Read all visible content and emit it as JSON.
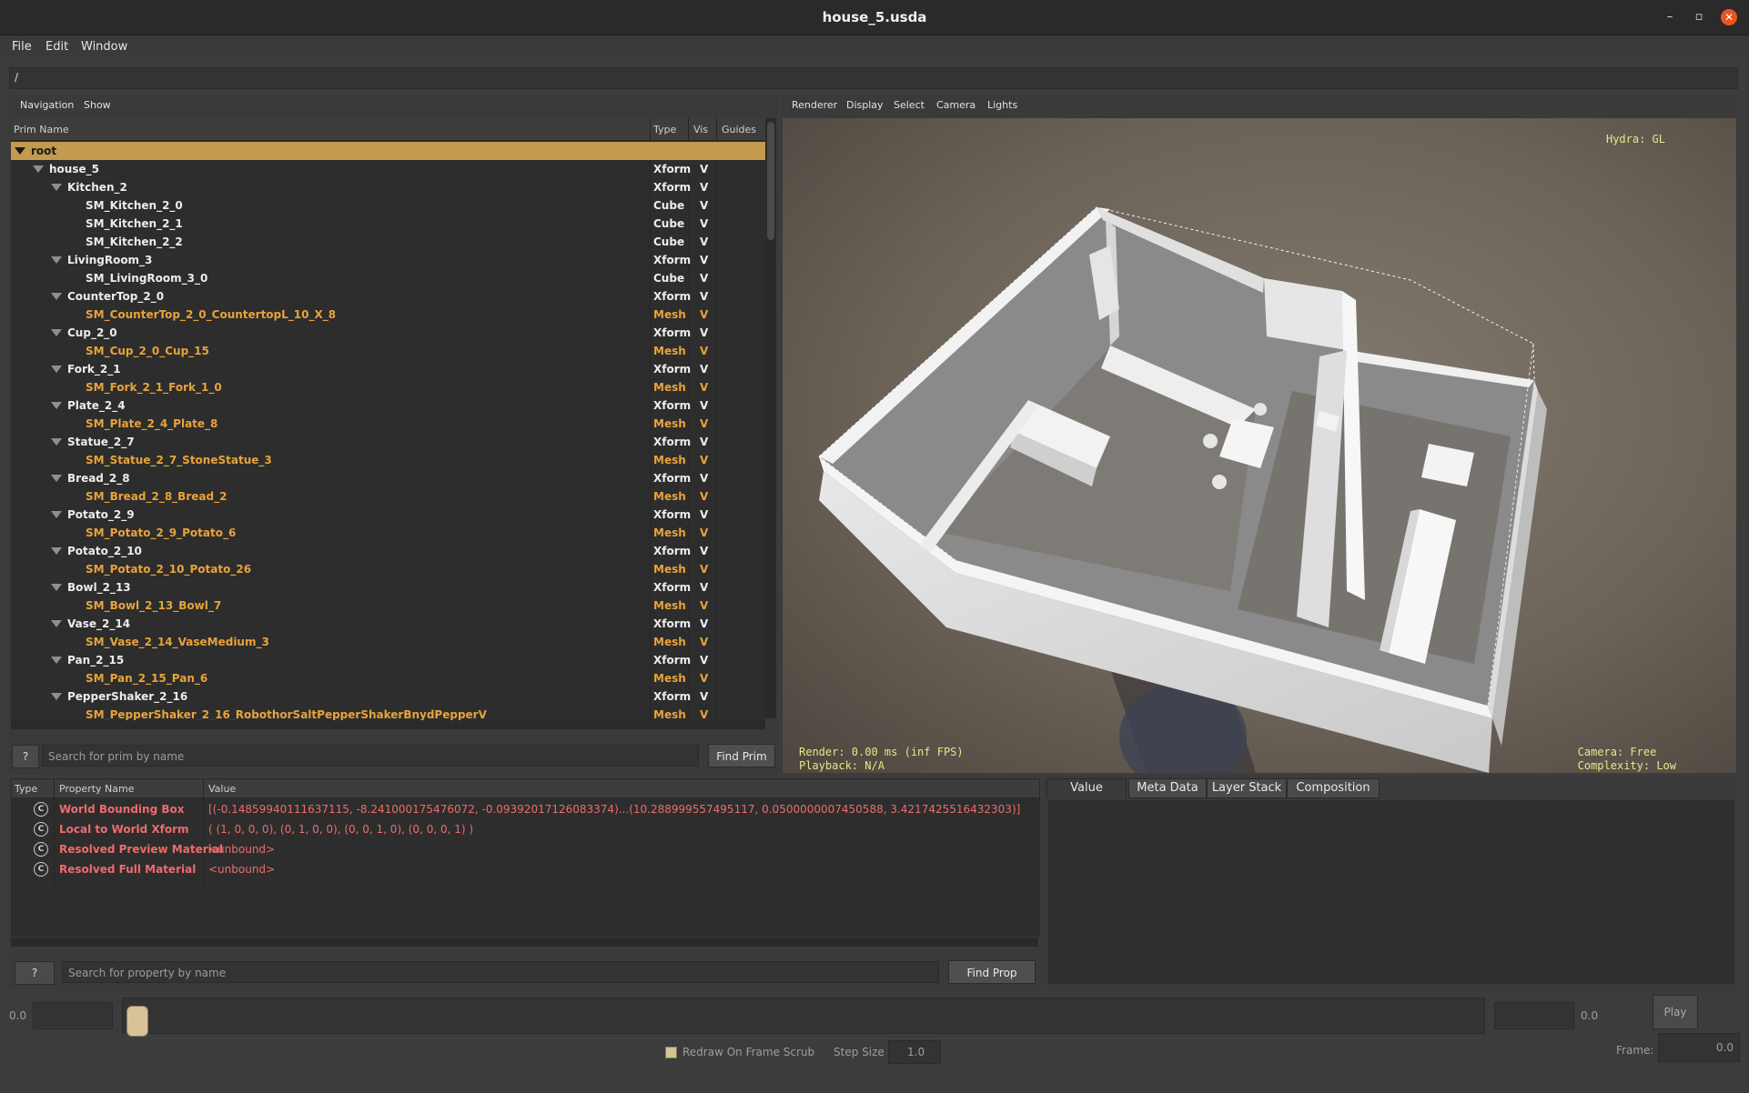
{
  "window": {
    "title": "house_5.usda",
    "controls": [
      "–",
      "▫",
      "✕"
    ]
  },
  "menu": {
    "items": [
      "File",
      "Edit",
      "Window"
    ]
  },
  "path": "/",
  "prim_panel": {
    "tabs": [
      "Navigation",
      "Show"
    ],
    "columns": [
      "Prim Name",
      "Type",
      "Vis",
      "Guides"
    ],
    "rows": [
      {
        "name": "root",
        "type": "",
        "vis": "",
        "color": "sel",
        "indent": 0,
        "expanded": true
      },
      {
        "name": "house_5",
        "type": "Xform",
        "vis": "V",
        "color": "white",
        "indent": 1,
        "expanded": true
      },
      {
        "name": "Kitchen_2",
        "type": "Xform",
        "vis": "V",
        "color": "white",
        "indent": 2,
        "expanded": true
      },
      {
        "name": "SM_Kitchen_2_0",
        "type": "Cube",
        "vis": "V",
        "color": "white",
        "indent": 3
      },
      {
        "name": "SM_Kitchen_2_1",
        "type": "Cube",
        "vis": "V",
        "color": "white",
        "indent": 3
      },
      {
        "name": "SM_Kitchen_2_2",
        "type": "Cube",
        "vis": "V",
        "color": "white",
        "indent": 3
      },
      {
        "name": "LivingRoom_3",
        "type": "Xform",
        "vis": "V",
        "color": "white",
        "indent": 2,
        "expanded": true
      },
      {
        "name": "SM_LivingRoom_3_0",
        "type": "Cube",
        "vis": "V",
        "color": "white",
        "indent": 3
      },
      {
        "name": "CounterTop_2_0",
        "type": "Xform",
        "vis": "V",
        "color": "white",
        "indent": 2,
        "expanded": true
      },
      {
        "name": "SM_CounterTop_2_0_CountertopL_10_X_8",
        "type": "Mesh",
        "vis": "V",
        "color": "orange",
        "indent": 3
      },
      {
        "name": "Cup_2_0",
        "type": "Xform",
        "vis": "V",
        "color": "white",
        "indent": 2,
        "expanded": true
      },
      {
        "name": "SM_Cup_2_0_Cup_15",
        "type": "Mesh",
        "vis": "V",
        "color": "orange",
        "indent": 3
      },
      {
        "name": "Fork_2_1",
        "type": "Xform",
        "vis": "V",
        "color": "white",
        "indent": 2,
        "expanded": true
      },
      {
        "name": "SM_Fork_2_1_Fork_1_0",
        "type": "Mesh",
        "vis": "V",
        "color": "orange",
        "indent": 3
      },
      {
        "name": "Plate_2_4",
        "type": "Xform",
        "vis": "V",
        "color": "white",
        "indent": 2,
        "expanded": true
      },
      {
        "name": "SM_Plate_2_4_Plate_8",
        "type": "Mesh",
        "vis": "V",
        "color": "orange",
        "indent": 3
      },
      {
        "name": "Statue_2_7",
        "type": "Xform",
        "vis": "V",
        "color": "white",
        "indent": 2,
        "expanded": true
      },
      {
        "name": "SM_Statue_2_7_StoneStatue_3",
        "type": "Mesh",
        "vis": "V",
        "color": "orange",
        "indent": 3
      },
      {
        "name": "Bread_2_8",
        "type": "Xform",
        "vis": "V",
        "color": "white",
        "indent": 2,
        "expanded": true
      },
      {
        "name": "SM_Bread_2_8_Bread_2",
        "type": "Mesh",
        "vis": "V",
        "color": "orange",
        "indent": 3
      },
      {
        "name": "Potato_2_9",
        "type": "Xform",
        "vis": "V",
        "color": "white",
        "indent": 2,
        "expanded": true
      },
      {
        "name": "SM_Potato_2_9_Potato_6",
        "type": "Mesh",
        "vis": "V",
        "color": "orange",
        "indent": 3
      },
      {
        "name": "Potato_2_10",
        "type": "Xform",
        "vis": "V",
        "color": "white",
        "indent": 2,
        "expanded": true
      },
      {
        "name": "SM_Potato_2_10_Potato_26",
        "type": "Mesh",
        "vis": "V",
        "color": "orange",
        "indent": 3
      },
      {
        "name": "Bowl_2_13",
        "type": "Xform",
        "vis": "V",
        "color": "white",
        "indent": 2,
        "expanded": true
      },
      {
        "name": "SM_Bowl_2_13_Bowl_7",
        "type": "Mesh",
        "vis": "V",
        "color": "orange",
        "indent": 3
      },
      {
        "name": "Vase_2_14",
        "type": "Xform",
        "vis": "V",
        "color": "white",
        "indent": 2,
        "expanded": true
      },
      {
        "name": "SM_Vase_2_14_VaseMedium_3",
        "type": "Mesh",
        "vis": "V",
        "color": "orange",
        "indent": 3
      },
      {
        "name": "Pan_2_15",
        "type": "Xform",
        "vis": "V",
        "color": "white",
        "indent": 2,
        "expanded": true
      },
      {
        "name": "SM_Pan_2_15_Pan_6",
        "type": "Mesh",
        "vis": "V",
        "color": "orange",
        "indent": 3
      },
      {
        "name": "PepperShaker_2_16",
        "type": "Xform",
        "vis": "V",
        "color": "white",
        "indent": 2,
        "expanded": true
      },
      {
        "name": "SM_PepperShaker_2_16_RobothorSaltPepperShakerBnydPepperV",
        "type": "Mesh",
        "vis": "V",
        "color": "orange",
        "indent": 3
      }
    ],
    "search": {
      "help": "?",
      "placeholder": "Search for prim by name",
      "button": "Find Prim"
    }
  },
  "viewport": {
    "menu": [
      "Renderer",
      "Display",
      "Select",
      "Camera",
      "Lights"
    ],
    "hud_top_right": "Hydra: GL",
    "hud_bottom_left": "Render: 0.00 ms (inf FPS)\nPlayback: N/A",
    "hud_bottom_right": "Camera: Free\nComplexity: Low"
  },
  "properties": {
    "columns": [
      "Type",
      "Property Name",
      "Value"
    ],
    "rows": [
      {
        "icon": "C",
        "name": "World Bounding Box",
        "value": "[(-0.14859940111637115, -8.241000175476072, -0.09392017126083374)...(10.288999557495117, 0.0500000007450588, 3.4217425516432303)]"
      },
      {
        "icon": "C",
        "name": "Local to World Xform",
        "value": "( (1, 0, 0, 0), (0, 1, 0, 0), (0, 0, 1, 0), (0, 0, 0, 1) )"
      },
      {
        "icon": "C",
        "name": "Resolved Preview Material",
        "value": "<unbound>"
      },
      {
        "icon": "C",
        "name": "Resolved Full Material",
        "value": "<unbound>"
      }
    ],
    "search": {
      "help": "?",
      "placeholder": "Search for property by name",
      "button": "Find Prop"
    }
  },
  "meta_tabs": [
    "Value",
    "Meta Data",
    "Layer Stack",
    "Composition"
  ],
  "timeline": {
    "start": "0.0",
    "end": "0.0",
    "redraw_label": "Redraw On Frame Scrub",
    "step_label": "Step Size",
    "step_value": "1.0",
    "play": "Play",
    "frame_label": "Frame:",
    "frame_value": "0.0"
  },
  "colors": {
    "selection": "#c39a4e",
    "mesh_text": "#e8a33b",
    "prop_text": "#ee6b6b",
    "hud": "#e6e68a"
  }
}
